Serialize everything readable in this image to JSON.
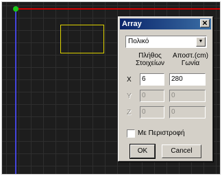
{
  "dialog": {
    "title": "Array",
    "close_glyph": "✕",
    "mode_value": "Πολικό",
    "mode_arrow": "▼",
    "col1_header_line1": "Πλήθος",
    "col1_header_line2": "Στοιχείων",
    "col2_header_line1": "Αποστ.(cm)",
    "col2_header_line2": "Γωνία",
    "row_x": {
      "label": "X",
      "count": "6",
      "value": "280"
    },
    "row_y": {
      "label": "Y",
      "count": "0",
      "value": "0"
    },
    "row_z": {
      "label": "Z",
      "count": "0",
      "value": "0"
    },
    "checkbox_label": "Με Περιστροφή",
    "ok_label": "OK",
    "cancel_label": "Cancel"
  }
}
